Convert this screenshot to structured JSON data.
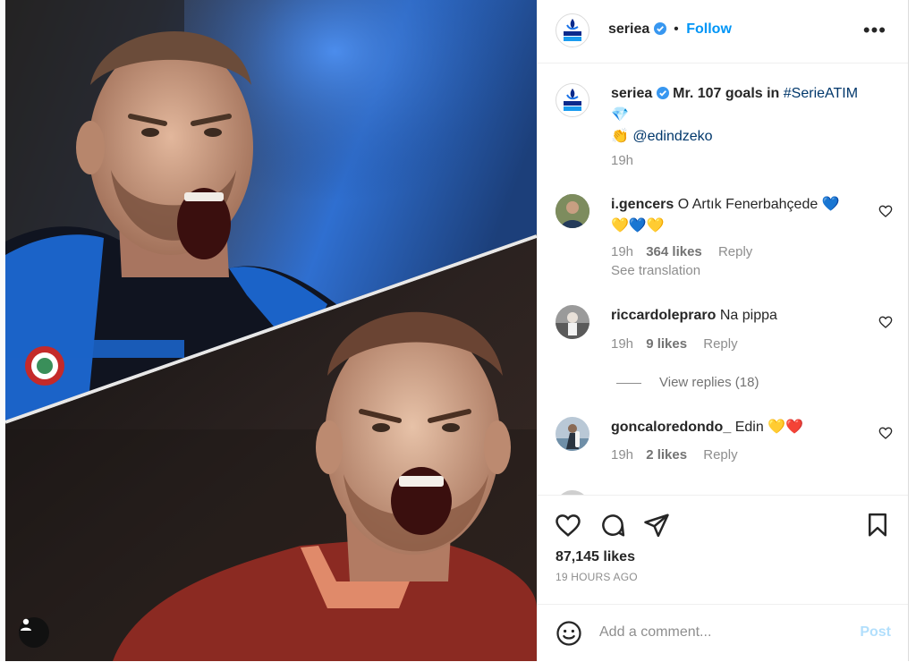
{
  "post": {
    "account": "seriea",
    "follow_label": "Follow",
    "separator": "•",
    "more_label": "•••",
    "logo_text_1": "SERIE A",
    "logo_text_2": "TIM"
  },
  "caption": {
    "username": "seriea",
    "text": "Mr. 107 goals in ",
    "hashtag": "#SerieATIM",
    "line2_emoji": "💎",
    "line3_emoji": "👏",
    "mention": "@edindzeko",
    "time": "19h"
  },
  "comments": [
    {
      "username": "i.gencers",
      "text": "O Artık Fenerbahçede",
      "emoji_line1": "💙",
      "emoji_line2": "💛💙💛",
      "time": "19h",
      "likes": "364 likes",
      "reply_label": "Reply",
      "translation_label": "See translation"
    },
    {
      "username": "riccardolepraro",
      "text": "Na pippa",
      "time": "19h",
      "likes": "9 likes",
      "reply_label": "Reply",
      "view_replies": "View replies (18)"
    },
    {
      "username": "goncaloredondo_",
      "text": "Edin",
      "emoji": "💛❤️",
      "time": "19h",
      "likes": "2 likes",
      "reply_label": "Reply"
    }
  ],
  "actions": {
    "likes": "87,145 likes",
    "time_ago": "19 HOURS AGO"
  },
  "add_comment": {
    "placeholder": "Add a comment...",
    "post_label": "Post"
  },
  "colors": {
    "accent": "#0095f6",
    "inter_blue": "#1b63c8",
    "roma_red": "#8b2a22"
  }
}
